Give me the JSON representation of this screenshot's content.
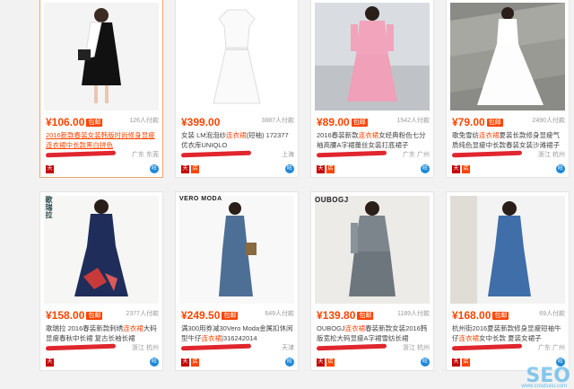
{
  "products": [
    {
      "price": "¥106.00",
      "badge": "包邮",
      "count": "126人付款",
      "title_pre": "2016新款春装女装韩版时尚修身显瘦连衣裙中长款黑白拼色",
      "title_hl": "连衣裙",
      "location": "广东 东莞",
      "selected": true
    },
    {
      "price": "¥399.00",
      "badge": "",
      "count": "3887人付款",
      "title_pre": "女装 LM泡泡纱",
      "title_hl": "连衣裙",
      "title_post": "(短袖) 172377 优衣库UNIQLO",
      "location": "上海",
      "selected": false
    },
    {
      "price": "¥89.00",
      "badge": "包邮",
      "count": "1542人付款",
      "title_pre": "2016春装新款",
      "title_hl": "连衣裙",
      "title_post": "女经典粉色七分袖高腰A字裙蕾丝女装打底裙子",
      "location": "广东 广州",
      "selected": false
    },
    {
      "price": "¥79.00",
      "badge": "包邮",
      "count": "2490人付款",
      "title_pre": "歌兔雪纺",
      "title_hl": "连衣裙",
      "title_post": "夏装长款修身显瘦气质纯色显瘦中长款春装女装沙滩裙子",
      "location": "浙江 杭州",
      "selected": false
    },
    {
      "price": "¥158.00",
      "badge": "包邮",
      "count": "2377人付款",
      "title_pre": "歌瑞拉 2016春装新款刺绣",
      "title_hl": "连衣裙",
      "title_post": "大码显瘦春秋中长裙 复古长袖长裙",
      "location": "浙江 杭州",
      "selected": false
    },
    {
      "price": "¥249.50",
      "badge": "包邮",
      "count": "649人付款",
      "title_pre": "满300用券减30Vero Moda金属扣休闲型牛仔",
      "title_hl": "连衣裙",
      "title_post": "|316242014",
      "location": "天津",
      "selected": false
    },
    {
      "price": "¥139.80",
      "badge": "包邮",
      "count": "1189人付款",
      "title_pre": "OUBOGJ",
      "title_hl": "连衣裙",
      "title_post": "春装新款女装2016韩版宽松大码显瘦A字裙雪纺长裙",
      "location": "浙江 杭州",
      "selected": false
    },
    {
      "price": "¥168.00",
      "badge": "包邮",
      "count": "69人付款",
      "title_pre": "杭州街2016夏装新款修身显瘦短袖牛仔",
      "title_hl": "连衣裙",
      "title_post": "女中长款 夏装女裙子",
      "location": "广东 广州",
      "selected": false
    }
  ],
  "brands": [
    "歌瑞拉",
    "VERO MODA",
    "OUBOGJ"
  ],
  "icons": {
    "tmall": "天",
    "store": "店",
    "wangwang": "旺"
  },
  "watermark": {
    "main": "SEO",
    "sub": "www.cosdsxiu.com"
  }
}
